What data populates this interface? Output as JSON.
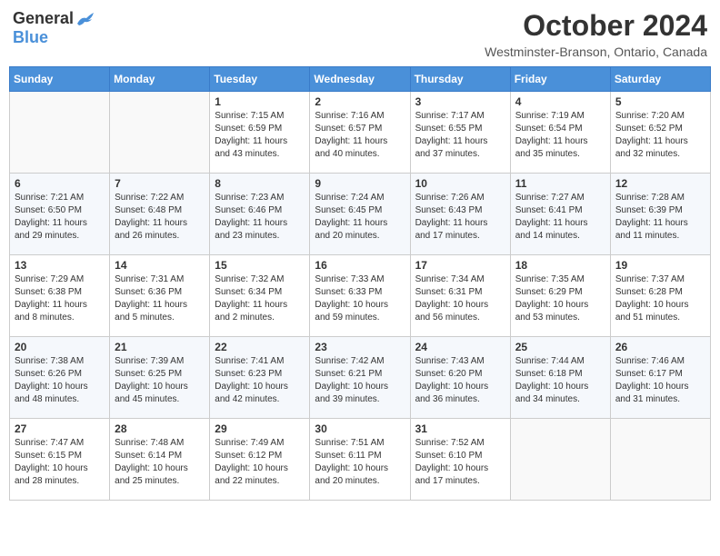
{
  "header": {
    "logo": {
      "general": "General",
      "blue": "Blue"
    },
    "title": "October 2024",
    "location": "Westminster-Branson, Ontario, Canada"
  },
  "calendar": {
    "days_of_week": [
      "Sunday",
      "Monday",
      "Tuesday",
      "Wednesday",
      "Thursday",
      "Friday",
      "Saturday"
    ],
    "weeks": [
      {
        "days": [
          {
            "date": "",
            "empty": true
          },
          {
            "date": "",
            "empty": true
          },
          {
            "date": "1",
            "sunrise": "7:15 AM",
            "sunset": "6:59 PM",
            "daylight": "11 hours and 43 minutes."
          },
          {
            "date": "2",
            "sunrise": "7:16 AM",
            "sunset": "6:57 PM",
            "daylight": "11 hours and 40 minutes."
          },
          {
            "date": "3",
            "sunrise": "7:17 AM",
            "sunset": "6:55 PM",
            "daylight": "11 hours and 37 minutes."
          },
          {
            "date": "4",
            "sunrise": "7:19 AM",
            "sunset": "6:54 PM",
            "daylight": "11 hours and 35 minutes."
          },
          {
            "date": "5",
            "sunrise": "7:20 AM",
            "sunset": "6:52 PM",
            "daylight": "11 hours and 32 minutes."
          }
        ]
      },
      {
        "days": [
          {
            "date": "6",
            "sunrise": "7:21 AM",
            "sunset": "6:50 PM",
            "daylight": "11 hours and 29 minutes."
          },
          {
            "date": "7",
            "sunrise": "7:22 AM",
            "sunset": "6:48 PM",
            "daylight": "11 hours and 26 minutes."
          },
          {
            "date": "8",
            "sunrise": "7:23 AM",
            "sunset": "6:46 PM",
            "daylight": "11 hours and 23 minutes."
          },
          {
            "date": "9",
            "sunrise": "7:24 AM",
            "sunset": "6:45 PM",
            "daylight": "11 hours and 20 minutes."
          },
          {
            "date": "10",
            "sunrise": "7:26 AM",
            "sunset": "6:43 PM",
            "daylight": "11 hours and 17 minutes."
          },
          {
            "date": "11",
            "sunrise": "7:27 AM",
            "sunset": "6:41 PM",
            "daylight": "11 hours and 14 minutes."
          },
          {
            "date": "12",
            "sunrise": "7:28 AM",
            "sunset": "6:39 PM",
            "daylight": "11 hours and 11 minutes."
          }
        ]
      },
      {
        "days": [
          {
            "date": "13",
            "sunrise": "7:29 AM",
            "sunset": "6:38 PM",
            "daylight": "11 hours and 8 minutes."
          },
          {
            "date": "14",
            "sunrise": "7:31 AM",
            "sunset": "6:36 PM",
            "daylight": "11 hours and 5 minutes."
          },
          {
            "date": "15",
            "sunrise": "7:32 AM",
            "sunset": "6:34 PM",
            "daylight": "11 hours and 2 minutes."
          },
          {
            "date": "16",
            "sunrise": "7:33 AM",
            "sunset": "6:33 PM",
            "daylight": "10 hours and 59 minutes."
          },
          {
            "date": "17",
            "sunrise": "7:34 AM",
            "sunset": "6:31 PM",
            "daylight": "10 hours and 56 minutes."
          },
          {
            "date": "18",
            "sunrise": "7:35 AM",
            "sunset": "6:29 PM",
            "daylight": "10 hours and 53 minutes."
          },
          {
            "date": "19",
            "sunrise": "7:37 AM",
            "sunset": "6:28 PM",
            "daylight": "10 hours and 51 minutes."
          }
        ]
      },
      {
        "days": [
          {
            "date": "20",
            "sunrise": "7:38 AM",
            "sunset": "6:26 PM",
            "daylight": "10 hours and 48 minutes."
          },
          {
            "date": "21",
            "sunrise": "7:39 AM",
            "sunset": "6:25 PM",
            "daylight": "10 hours and 45 minutes."
          },
          {
            "date": "22",
            "sunrise": "7:41 AM",
            "sunset": "6:23 PM",
            "daylight": "10 hours and 42 minutes."
          },
          {
            "date": "23",
            "sunrise": "7:42 AM",
            "sunset": "6:21 PM",
            "daylight": "10 hours and 39 minutes."
          },
          {
            "date": "24",
            "sunrise": "7:43 AM",
            "sunset": "6:20 PM",
            "daylight": "10 hours and 36 minutes."
          },
          {
            "date": "25",
            "sunrise": "7:44 AM",
            "sunset": "6:18 PM",
            "daylight": "10 hours and 34 minutes."
          },
          {
            "date": "26",
            "sunrise": "7:46 AM",
            "sunset": "6:17 PM",
            "daylight": "10 hours and 31 minutes."
          }
        ]
      },
      {
        "days": [
          {
            "date": "27",
            "sunrise": "7:47 AM",
            "sunset": "6:15 PM",
            "daylight": "10 hours and 28 minutes."
          },
          {
            "date": "28",
            "sunrise": "7:48 AM",
            "sunset": "6:14 PM",
            "daylight": "10 hours and 25 minutes."
          },
          {
            "date": "29",
            "sunrise": "7:49 AM",
            "sunset": "6:12 PM",
            "daylight": "10 hours and 22 minutes."
          },
          {
            "date": "30",
            "sunrise": "7:51 AM",
            "sunset": "6:11 PM",
            "daylight": "10 hours and 20 minutes."
          },
          {
            "date": "31",
            "sunrise": "7:52 AM",
            "sunset": "6:10 PM",
            "daylight": "10 hours and 17 minutes."
          },
          {
            "date": "",
            "empty": true
          },
          {
            "date": "",
            "empty": true
          }
        ]
      }
    ]
  }
}
